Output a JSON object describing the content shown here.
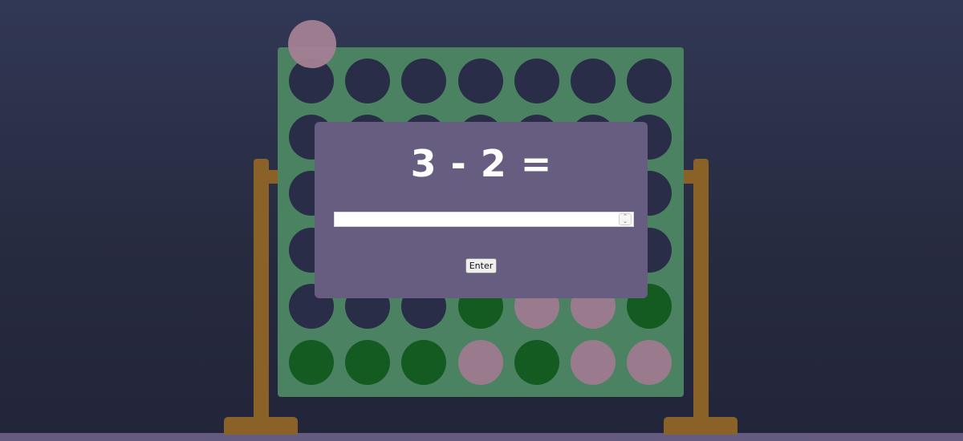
{
  "colors": {
    "background_top": "#313855",
    "background_bottom": "#22253a",
    "board": "#4b8262",
    "stand": "#8a6228",
    "empty_slot": "#292d48",
    "player_green": "#135b20",
    "player_pink": "#9a7b8d",
    "modal": "#665d80",
    "floor": "#645c80"
  },
  "board": {
    "columns": 7,
    "rows": 6,
    "cells": [
      [
        "empty",
        "empty",
        "empty",
        "empty",
        "empty",
        "empty",
        "empty"
      ],
      [
        "empty",
        "empty",
        "empty",
        "empty",
        "empty",
        "empty",
        "empty"
      ],
      [
        "empty",
        "empty",
        "empty",
        "empty",
        "empty",
        "empty",
        "empty"
      ],
      [
        "empty",
        "empty",
        "empty",
        "empty",
        "empty",
        "empty",
        "empty"
      ],
      [
        "empty",
        "empty",
        "empty",
        "green",
        "pink",
        "pink",
        "green"
      ],
      [
        "green",
        "green",
        "green",
        "pink",
        "green",
        "pink",
        "pink"
      ]
    ]
  },
  "hover_piece": {
    "color": "pink",
    "column": 1
  },
  "modal": {
    "question": "3 - 2 =",
    "answer_value": "",
    "enter_label": "Enter"
  },
  "icons": {
    "spin_up": "chevron-up-icon",
    "spin_down": "chevron-down-icon"
  }
}
